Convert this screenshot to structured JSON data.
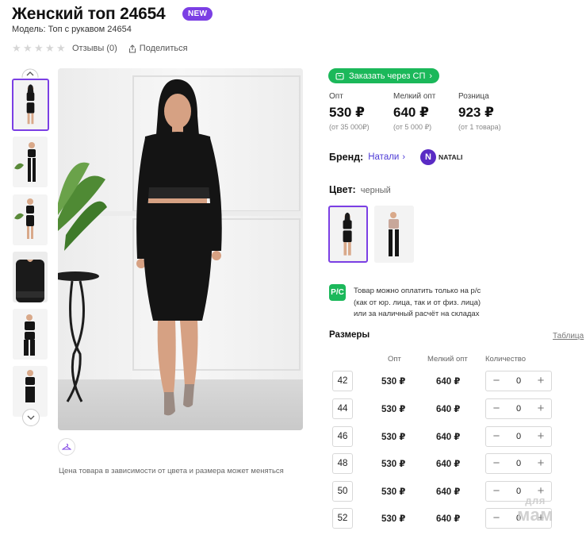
{
  "product": {
    "title": "Женский топ 24654",
    "badge": "NEW",
    "model": "Модель: Топ с рукавом 24654",
    "reviews": "Отзывы (0)",
    "share": "Поделиться",
    "rating": 0,
    "rating_max": 5
  },
  "gallery": {
    "thumbnails": [
      "thumb-1",
      "thumb-2",
      "thumb-3",
      "thumb-4",
      "thumb-5",
      "thumb-6"
    ],
    "active_index": 0,
    "price_note": "Цена товара в зависимости от цвета и размера может меняться"
  },
  "order": {
    "button_label": "Заказать через СП"
  },
  "prices": [
    {
      "label": "Опт",
      "value": "530 ₽",
      "min": "(от 35 000₽)"
    },
    {
      "label": "Мелкий опт",
      "value": "640 ₽",
      "min": "(от 5 000 ₽)"
    },
    {
      "label": "Розница",
      "value": "923 ₽",
      "min": "(от 1 товара)"
    }
  ],
  "brand": {
    "label": "Бренд:",
    "name": "Натали",
    "logo_letter": "N",
    "logo_text": "NATALI"
  },
  "color": {
    "label": "Цвет:",
    "value": "черный",
    "swatches": [
      "black",
      "beige-top"
    ]
  },
  "payment": {
    "icon_text": "P/C",
    "lines": [
      "Товар можно оплатить только на р/с",
      "(как от юр. лица, так и от физ. лица)",
      "или за наличный расчёт на складах"
    ]
  },
  "sizes": {
    "title": "Размеры",
    "table_link": "Таблица",
    "headers": {
      "opt": "Опт",
      "small_opt": "Мелкий опт",
      "qty": "Количество"
    },
    "rows": [
      {
        "size": "42",
        "opt": "530 ₽",
        "small_opt": "640 ₽",
        "qty": "0"
      },
      {
        "size": "44",
        "opt": "530 ₽",
        "small_opt": "640 ₽",
        "qty": "0"
      },
      {
        "size": "46",
        "opt": "530 ₽",
        "small_opt": "640 ₽",
        "qty": "0"
      },
      {
        "size": "48",
        "opt": "530 ₽",
        "small_opt": "640 ₽",
        "qty": "0"
      },
      {
        "size": "50",
        "opt": "530 ₽",
        "small_opt": "640 ₽",
        "qty": "0"
      },
      {
        "size": "52",
        "opt": "530 ₽",
        "small_opt": "640 ₽",
        "qty": "0"
      }
    ]
  },
  "watermark": {
    "line1": "для",
    "line2": "мам"
  },
  "colors": {
    "accent": "#7b3fe4",
    "green": "#1bb85a",
    "link": "#4d3bd6"
  }
}
